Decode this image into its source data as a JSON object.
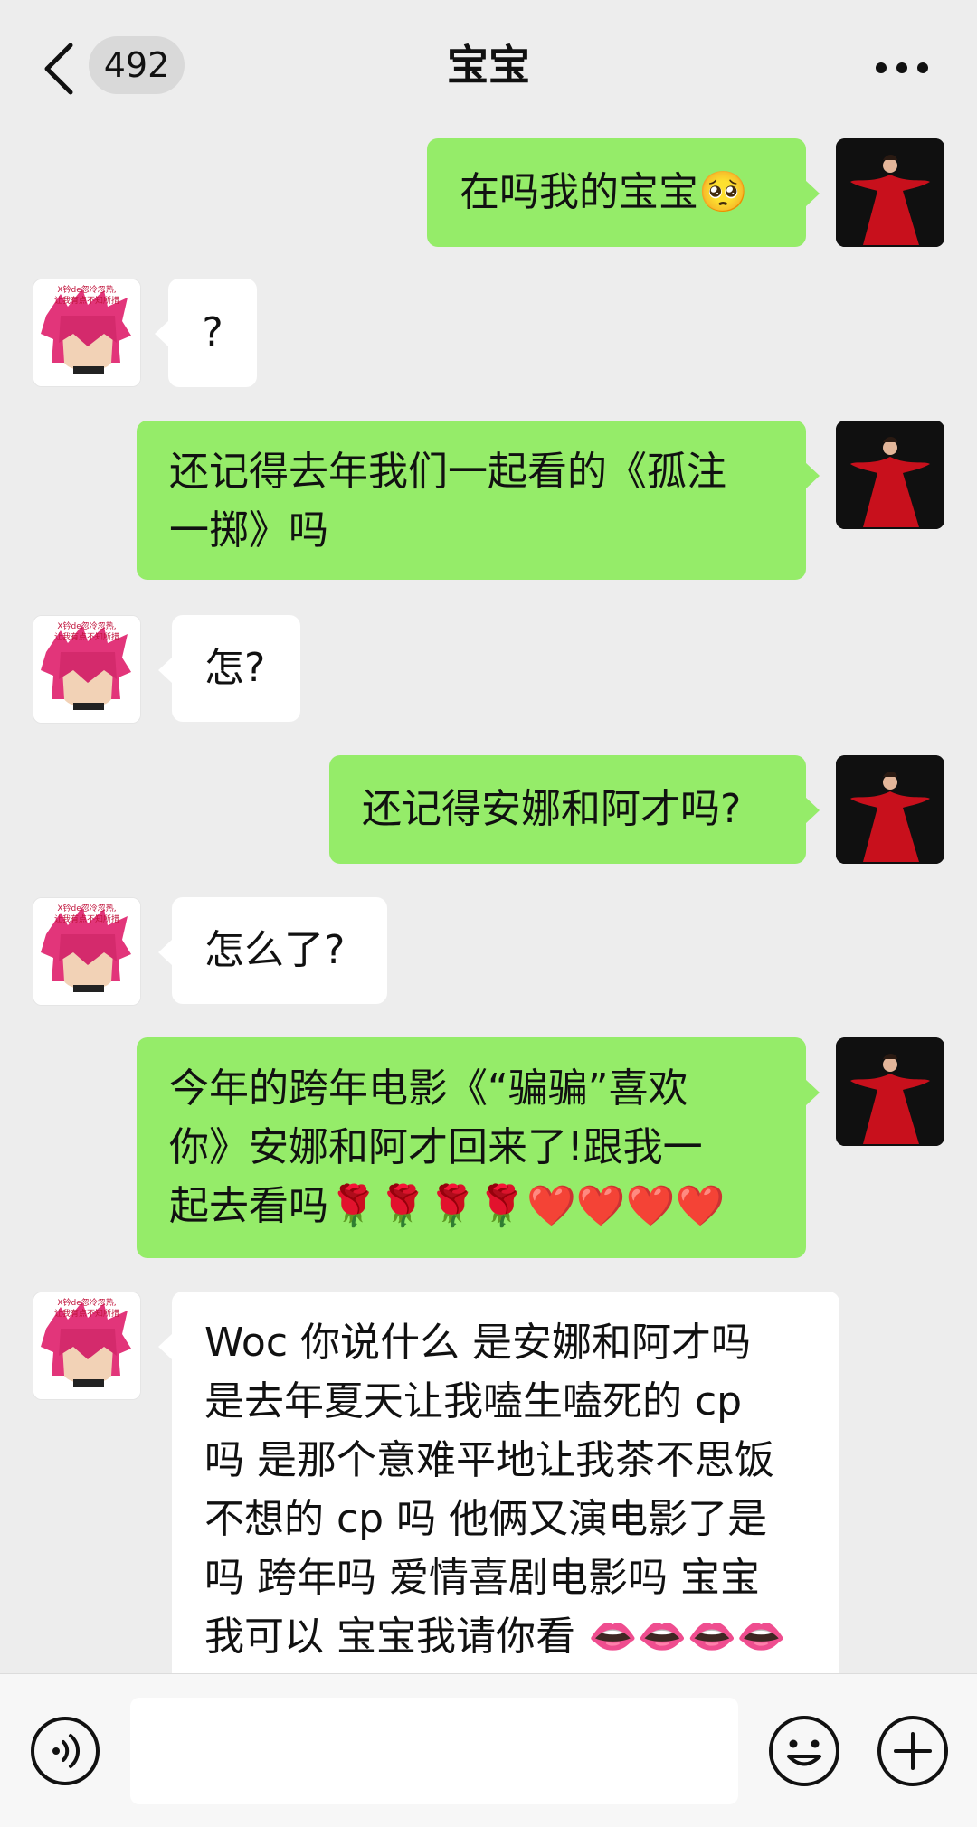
{
  "header": {
    "unread_count": "492",
    "title": "宝宝"
  },
  "messages": [
    {
      "sender": "me",
      "text": "在吗我的宝宝🥺"
    },
    {
      "sender": "them",
      "text": "?"
    },
    {
      "sender": "me",
      "text": "还记得去年我们一起看的《孤注\n一掷》吗"
    },
    {
      "sender": "them",
      "text": "怎?"
    },
    {
      "sender": "me",
      "text": "还记得安娜和阿才吗?"
    },
    {
      "sender": "them",
      "text": "怎么了?"
    },
    {
      "sender": "me",
      "text": "今年的跨年电影《“骗骗”喜欢\n你》安娜和阿才回来了!跟我一\n起去看吗🌹🌹🌹🌹❤️❤️❤️❤️"
    },
    {
      "sender": "them",
      "text": "Woc 你说什么 是安娜和阿才吗\n是去年夏天让我嗑生嗑死的 cp\n吗 是那个意难平地让我茶不思饭\n不想的 cp 吗 他俩又演电影了是\n吗 跨年吗 爱情喜剧电影吗 宝宝\n我可以 宝宝我请你看 👄👄👄👄"
    }
  ],
  "avatars": {
    "them_caption": "X钤de忽冷忽热,\n让我有点不知所措"
  },
  "input": {
    "value": ""
  },
  "colors": {
    "background": "#ededed",
    "my_bubble": "#95ec69",
    "their_bubble": "#ffffff",
    "dress_red": "#c8101c"
  },
  "icons": [
    "back-chevron-icon",
    "more-icon",
    "voice-icon",
    "emoji-icon",
    "plus-icon"
  ]
}
